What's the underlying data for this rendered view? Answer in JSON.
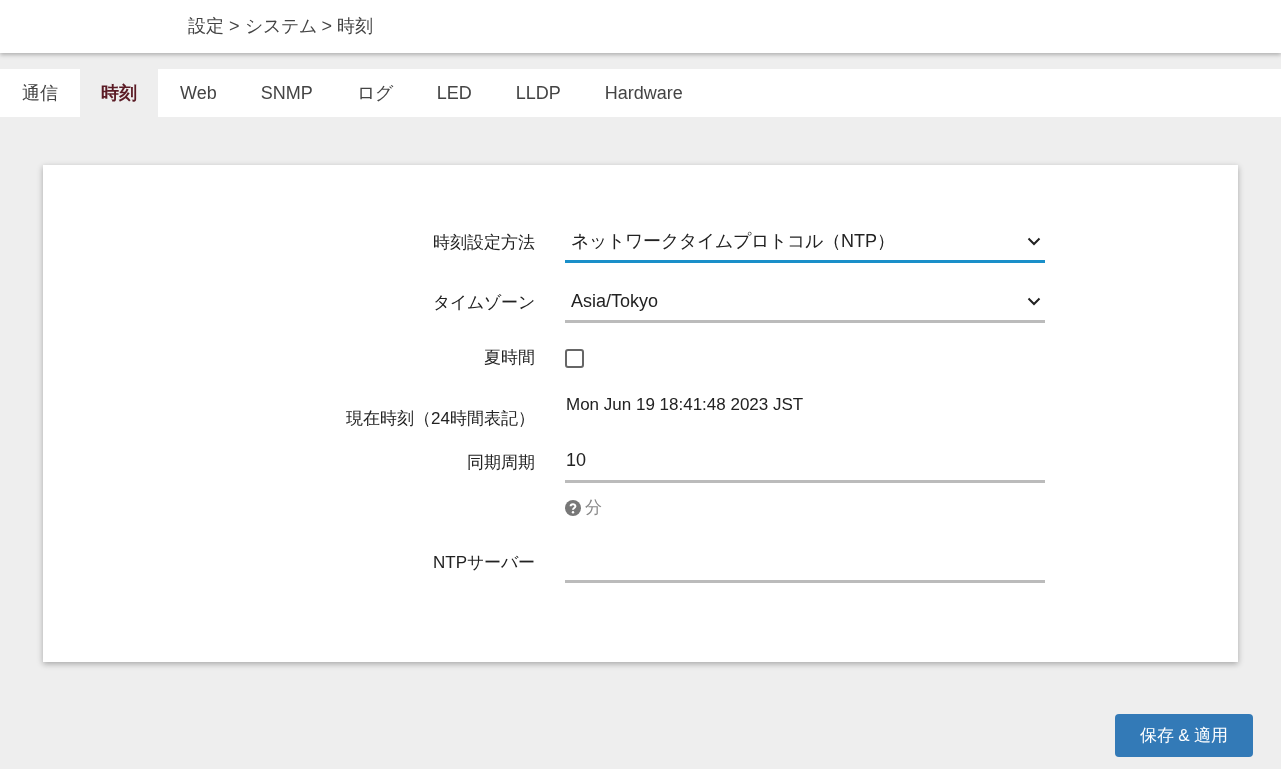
{
  "breadcrumb": "設定 > システム > 時刻",
  "tabs": [
    {
      "label": "通信",
      "selected": false
    },
    {
      "label": "時刻",
      "selected": true
    },
    {
      "label": "Web",
      "selected": false
    },
    {
      "label": "SNMP",
      "selected": false
    },
    {
      "label": "ログ",
      "selected": false
    },
    {
      "label": "LED",
      "selected": false
    },
    {
      "label": "LLDP",
      "selected": false
    },
    {
      "label": "Hardware",
      "selected": false
    }
  ],
  "form": [
    {
      "kind": "select",
      "label": "時刻設定方法",
      "value": "ネットワークタイムプロトコル（NTP）",
      "focused": true
    },
    {
      "kind": "select",
      "label": "タイムゾーン",
      "value": "Asia/Tokyo",
      "focused": false
    },
    {
      "kind": "checkbox",
      "label": "夏時間",
      "checked": false
    },
    {
      "kind": "text",
      "label": "現在時刻（24時間表記）",
      "value": "Mon Jun 19 18:41:48 2023 JST"
    },
    {
      "kind": "input",
      "label": "同期周期",
      "value": "10",
      "hint": "分"
    },
    {
      "kind": "input",
      "label": "NTPサーバー"
    }
  ],
  "save_button": "保存 & 適用"
}
